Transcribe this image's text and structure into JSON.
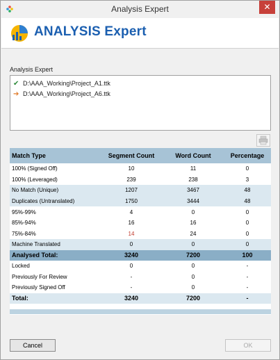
{
  "window": {
    "title": "Analysis Expert",
    "close_label": "✕"
  },
  "banner": {
    "brand": "ANALYSIS Expert"
  },
  "files": {
    "label": "Analysis Expert",
    "items": [
      {
        "status": "check",
        "mark": "✔",
        "path": "D:\\AAA_Working\\Project_A1.ttk",
        "color": "#2e8b3a"
      },
      {
        "status": "arrow",
        "mark": "➔",
        "path": "D:\\AAA_Working\\Project_A6.ttk",
        "color": "#e07b2a"
      }
    ]
  },
  "table": {
    "headers": [
      "Match Type",
      "Segment Count",
      "Word Count",
      "Percentage"
    ],
    "rows": [
      {
        "type": "100% (Signed Off)",
        "segments": "10",
        "words": "11",
        "percent": "0",
        "red": false
      },
      {
        "type": "100% (Leveraged)",
        "segments": "239",
        "words": "238",
        "percent": "3",
        "red": false
      },
      {
        "type": "No Match (Unique)",
        "segments": "1207",
        "words": "3467",
        "percent": "48",
        "red": false
      },
      {
        "type": "Duplicates (Untranslated)",
        "segments": "1750",
        "words": "3444",
        "percent": "48",
        "red": false
      },
      {
        "type": "95%-99%",
        "segments": "4",
        "words": "0",
        "percent": "0",
        "red": false
      },
      {
        "type": "85%-94%",
        "segments": "16",
        "words": "16",
        "percent": "0",
        "red": false
      },
      {
        "type": "75%-84%",
        "segments": "14",
        "words": "24",
        "percent": "0",
        "red": true
      },
      {
        "type": "Machine Translated",
        "segments": "0",
        "words": "0",
        "percent": "0",
        "red": false
      }
    ],
    "analysed_total": {
      "label": "Analysed Total:",
      "segments": "3240",
      "words": "7200",
      "percent": "100"
    },
    "extra_rows": [
      {
        "type": "Locked",
        "segments": "0",
        "words": "0",
        "percent": "-"
      },
      {
        "type": "Previously For Review",
        "segments": "-",
        "words": "0",
        "percent": "-"
      },
      {
        "type": "Previously Signed Off",
        "segments": "-",
        "words": "0",
        "percent": "-"
      }
    ],
    "total": {
      "label": "Total:",
      "segments": "3240",
      "words": "7200",
      "percent": "-"
    }
  },
  "buttons": {
    "cancel": "Cancel",
    "ok": "OK"
  },
  "colors": {
    "brand": "#1b5fb0",
    "header_bg": "#a7c3d6",
    "alt_row_bg": "#dbe8f0",
    "analysed_bg": "#8aaec6",
    "close_bg": "#c7403a"
  }
}
